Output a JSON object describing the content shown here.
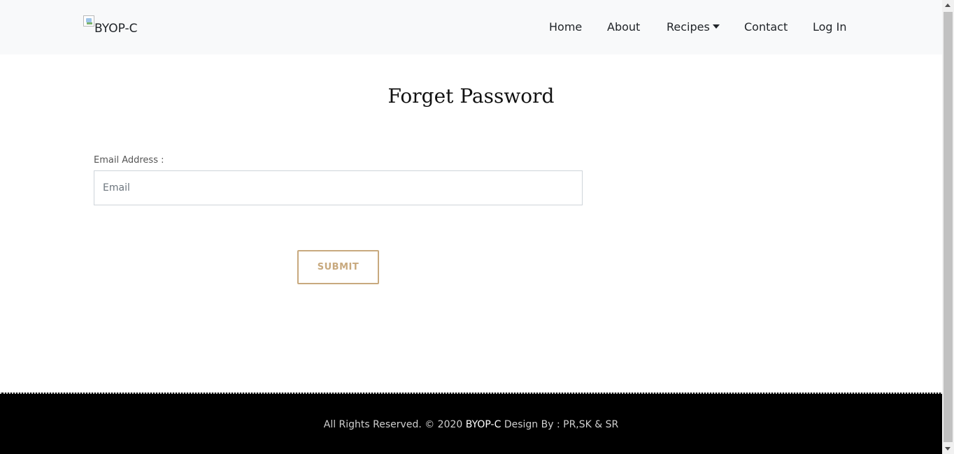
{
  "navbar": {
    "brand_alt": "BYOP-C",
    "links": [
      {
        "label": "Home"
      },
      {
        "label": "About"
      },
      {
        "label": "Recipes"
      },
      {
        "label": "Contact"
      },
      {
        "label": "Log In"
      }
    ]
  },
  "main": {
    "title": "Forget Password",
    "email_label": "Email Address :",
    "email_placeholder": "Email",
    "email_value": "",
    "submit_label": "SUBMIT"
  },
  "footer": {
    "prefix": "All Rights Reserved. © 2020",
    "brand": "BYOP-C",
    "suffix": "Design By : PR,SK & SR"
  },
  "colors": {
    "accent": "#c8a97e",
    "navbar_bg": "#f8f9fa",
    "footer_bg": "#000000"
  },
  "icons": {
    "brand_logo": "broken-image-icon",
    "recipes_dropdown": "caret-down-icon"
  }
}
